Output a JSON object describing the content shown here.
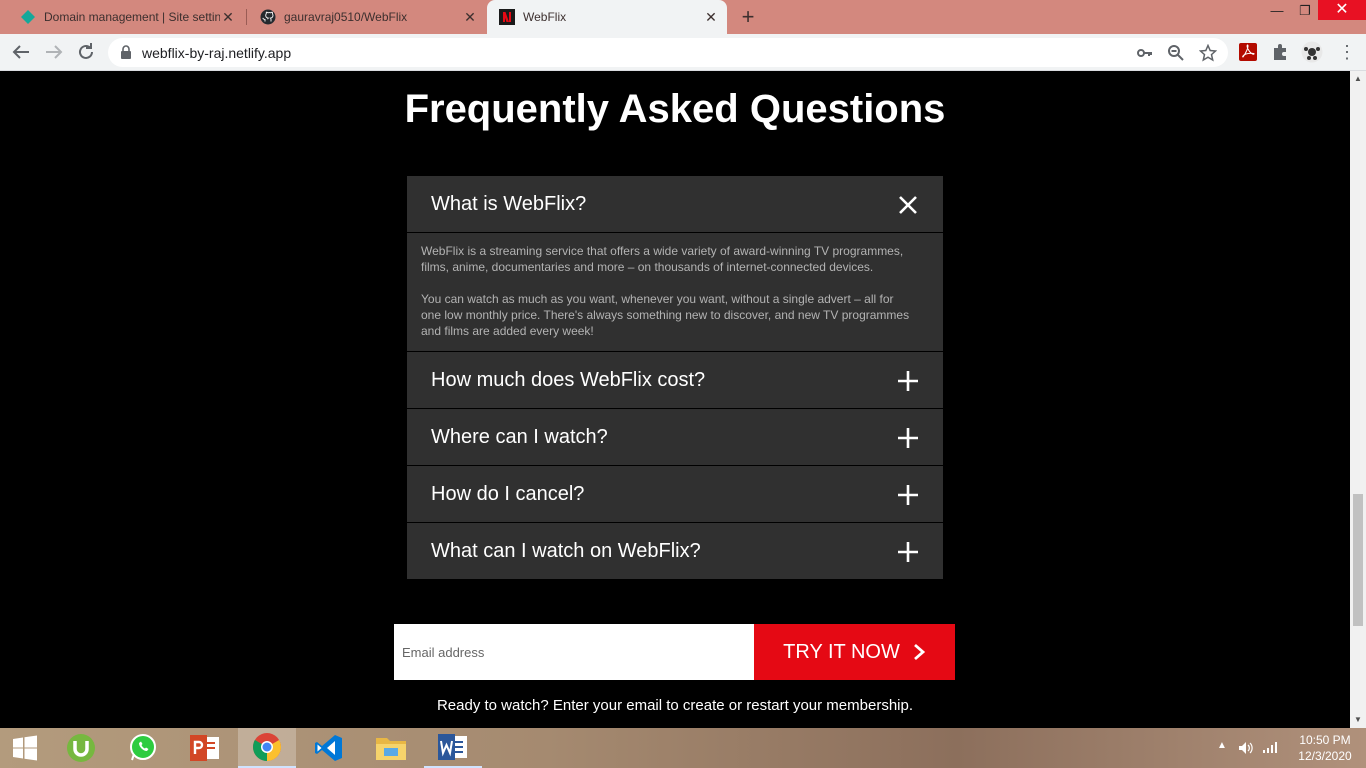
{
  "browser": {
    "tabs": [
      {
        "title": "Domain management | Site settin",
        "active": false
      },
      {
        "title": "gauravraj0510/WebFlix",
        "active": false
      },
      {
        "title": "WebFlix",
        "active": true
      }
    ],
    "url": "webflix-by-raj.netlify.app"
  },
  "page": {
    "faq_heading": "Frequently Asked Questions",
    "faq": [
      {
        "question": "What is WebFlix?",
        "expanded": true,
        "answer": [
          "WebFlix is a streaming service that offers a wide variety of award-winning TV programmes, films, anime, documentaries and more – on thousands of internet-connected devices.",
          "You can watch as much as you want, whenever you want, without a single advert – all for one low monthly price. There's always something new to discover, and new TV programmes and films are added every week!"
        ]
      },
      {
        "question": "How much does WebFlix cost?",
        "expanded": false
      },
      {
        "question": "Where can I watch?",
        "expanded": false
      },
      {
        "question": "How do I cancel?",
        "expanded": false
      },
      {
        "question": "What can I watch on WebFlix?",
        "expanded": false
      }
    ],
    "email_placeholder": "Email address",
    "cta_button": "TRY IT NOW",
    "cta_text": "Ready to watch? Enter your email to create or restart your membership."
  },
  "taskbar": {
    "time": "10:50 PM",
    "date": "12/3/2020"
  },
  "colors": {
    "brand_red": "#e50914",
    "faq_bg": "#303030",
    "tabstrip": "#d3887e"
  }
}
